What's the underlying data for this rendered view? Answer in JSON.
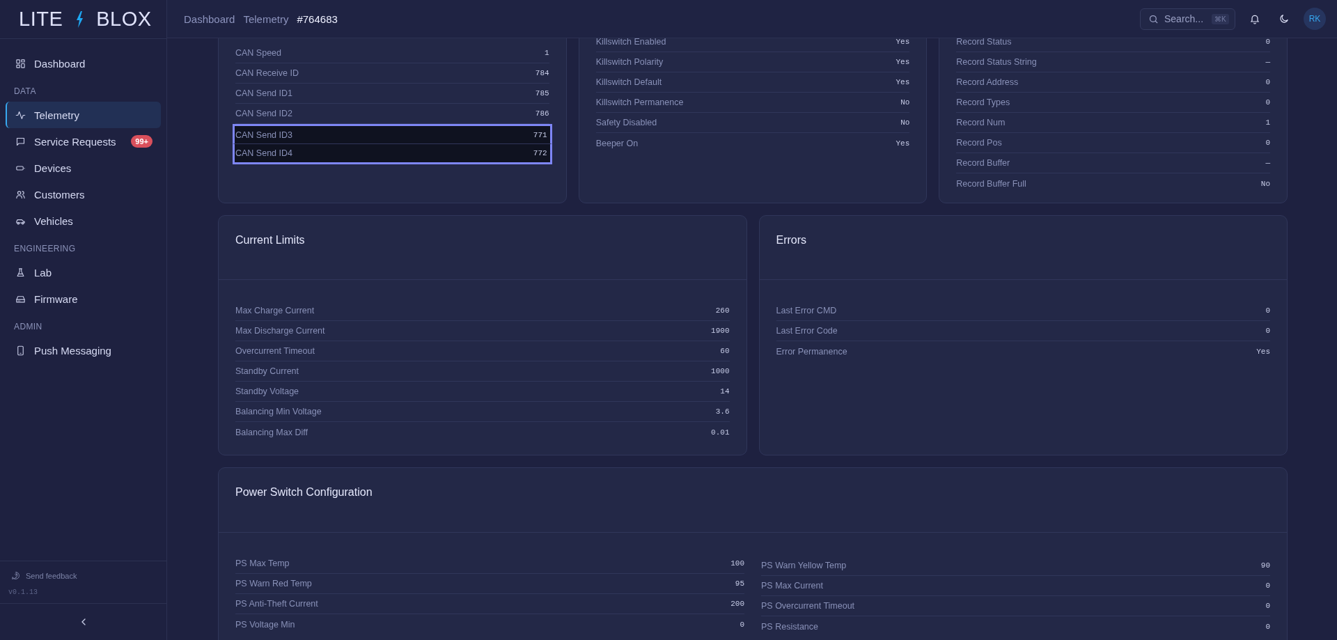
{
  "brand": {
    "left": "LITE",
    "right": "BLOX"
  },
  "nav": [
    {
      "kind": "item",
      "label": "Dashboard",
      "selected": false
    },
    {
      "kind": "heading",
      "label": "DATA"
    },
    {
      "kind": "item",
      "label": "Telemetry",
      "selected": true
    },
    {
      "kind": "item",
      "label": "Service Requests",
      "selected": false,
      "badge": "99+"
    },
    {
      "kind": "item",
      "label": "Devices",
      "selected": false
    },
    {
      "kind": "item",
      "label": "Customers",
      "selected": false
    },
    {
      "kind": "item",
      "label": "Vehicles",
      "selected": false
    },
    {
      "kind": "heading",
      "label": "ENGINEERING"
    },
    {
      "kind": "item",
      "label": "Lab",
      "selected": false
    },
    {
      "kind": "item",
      "label": "Firmware",
      "selected": false
    },
    {
      "kind": "heading",
      "label": "ADMIN"
    },
    {
      "kind": "item",
      "label": "Push Messaging",
      "selected": false
    }
  ],
  "footer": {
    "feedback": "Send feedback",
    "version": "v0.1.13"
  },
  "breadcrumb": [
    {
      "label": "Dashboard",
      "selected": false
    },
    {
      "label": "Telemetry",
      "selected": false
    },
    {
      "label": "#764683",
      "selected": true
    }
  ],
  "search": {
    "placeholder": "Search...",
    "shortcut": "⌘K"
  },
  "avatar": "RK",
  "top_cards": [
    {
      "rows": [
        {
          "label": "CAN Speed",
          "value": "1",
          "selected": false
        },
        {
          "label": "CAN Receive ID",
          "value": "784",
          "selected": false
        },
        {
          "label": "CAN Send ID1",
          "value": "785",
          "selected": false
        },
        {
          "label": "CAN Send ID2",
          "value": "786",
          "selected": false
        },
        {
          "label": "CAN Send ID3",
          "value": "771",
          "selected": true
        },
        {
          "label": "CAN Send ID4",
          "value": "772",
          "selected": true
        }
      ]
    },
    {
      "rows": [
        {
          "label": "Killswitch Enabled",
          "value": "Yes",
          "selected": false
        },
        {
          "label": "Killswitch Polarity",
          "value": "Yes",
          "selected": false
        },
        {
          "label": "Killswitch Default",
          "value": "Yes",
          "selected": false
        },
        {
          "label": "Killswitch Permanence",
          "value": "No",
          "selected": false
        },
        {
          "label": "Safety Disabled",
          "value": "No",
          "selected": false
        },
        {
          "label": "Beeper On",
          "value": "Yes",
          "selected": false
        }
      ]
    },
    {
      "rows": [
        {
          "label": "Record Status",
          "value": "0",
          "selected": false
        },
        {
          "label": "Record Status String",
          "value": "—",
          "selected": false
        },
        {
          "label": "Record Address",
          "value": "0",
          "selected": false
        },
        {
          "label": "Record Types",
          "value": "0",
          "selected": false
        },
        {
          "label": "Record Num",
          "value": "1",
          "selected": false
        },
        {
          "label": "Record Pos",
          "value": "0",
          "selected": false
        },
        {
          "label": "Record Buffer",
          "value": "—",
          "selected": false
        },
        {
          "label": "Record Buffer Full",
          "value": "No",
          "selected": false
        }
      ]
    }
  ],
  "mid_cards": [
    {
      "title": "Current Limits",
      "rows": [
        {
          "label": "Max Charge Current",
          "value": "260"
        },
        {
          "label": "Max Discharge Current",
          "value": "1900"
        },
        {
          "label": "Overcurrent Timeout",
          "value": "60"
        },
        {
          "label": "Standby Current",
          "value": "1000"
        },
        {
          "label": "Standby Voltage",
          "value": "14"
        },
        {
          "label": "Balancing Min Voltage",
          "value": "3.6"
        },
        {
          "label": "Balancing Max Diff",
          "value": "0.01"
        }
      ]
    },
    {
      "title": "Errors",
      "rows": [
        {
          "label": "Last Error CMD",
          "value": "0"
        },
        {
          "label": "Last Error Code",
          "value": "0"
        },
        {
          "label": "Error Permanence",
          "value": "Yes"
        }
      ]
    }
  ],
  "power": {
    "title": "Power Switch Configuration",
    "columns": [
      [
        {
          "label": "PS Max Temp",
          "value": "100"
        },
        {
          "label": "PS Warn Red Temp",
          "value": "95"
        },
        {
          "label": "PS Anti-Theft Current",
          "value": "200"
        },
        {
          "label": "PS Voltage Min",
          "value": "0"
        }
      ],
      [
        {
          "label": "PS Warn Yellow Temp",
          "value": "90"
        },
        {
          "label": "PS Max Current",
          "value": "0"
        },
        {
          "label": "PS Overcurrent Timeout",
          "value": "0"
        },
        {
          "label": "PS Resistance",
          "value": "0"
        }
      ]
    ]
  }
}
